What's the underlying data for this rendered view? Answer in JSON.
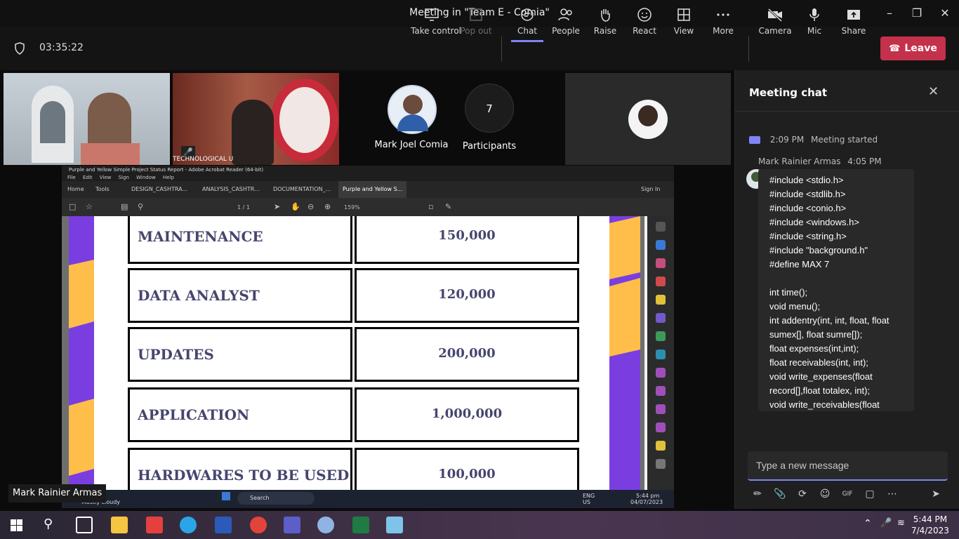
{
  "window": {
    "title": "Meeting in \"Team E - Comia\""
  },
  "meeting": {
    "timer": "03:35:22"
  },
  "toolbar": {
    "take_control": "Take control",
    "pop_out": "Pop out",
    "chat": "Chat",
    "people": "People",
    "raise": "Raise",
    "react": "React",
    "view": "View",
    "more": "More",
    "camera": "Camera",
    "mic": "Mic",
    "share": "Share",
    "leave": "Leave"
  },
  "participants": {
    "tile_name": "Mark Joel Comia",
    "count": "7",
    "count_label": "Participants",
    "tile2_caption": "TECHNOLOGICAL U"
  },
  "shared_screen": {
    "presenter": "Mark Rainier Armas",
    "app_title": "Purple and Yellow Simple Project Status Report - Adobe Acrobat Reader (64-bit)",
    "menu": [
      "File",
      "Edit",
      "View",
      "Sign",
      "Window",
      "Help"
    ],
    "nav": {
      "home": "Home",
      "tools": "Tools",
      "sign_in": "Sign In"
    },
    "tabs": [
      "DESIGN_CASHTRA...",
      "ANALYSIS_CASHTR...",
      "DOCUMENTATION_...",
      "Purple and Yellow S..."
    ],
    "page_indicator": "1 / 1",
    "zoom": "159%",
    "rows": [
      {
        "label": "MAINTENANCE",
        "value": "150,000"
      },
      {
        "label": "DATA ANALYST",
        "value": "120,000"
      },
      {
        "label": "UPDATES",
        "value": "200,000"
      },
      {
        "label": "APPLICATION",
        "value": "1,000,000"
      },
      {
        "label": "HARDWARES TO BE USED",
        "value": "100,000"
      }
    ],
    "taskbar": {
      "weather": "Mostly cloudy",
      "weather_temp": "C",
      "search": "Search",
      "lang": "ENG",
      "region": "US",
      "time": "5:44 pm",
      "date": "04/07/2023"
    }
  },
  "chat": {
    "title": "Meeting chat",
    "system_time": "2:09 PM",
    "system_text": "Meeting started",
    "sender": "Mark Rainier Armas",
    "sender_time": "4:05 PM",
    "message": "#include <stdio.h>\n#include <stdlib.h>\n#include <conio.h>\n#include <windows.h>\n#include <string.h>\n#include \"background.h\"\n#define MAX 7\n\nint time();\nvoid menu();\nint addentry(int, int, float, float sumex[], float sumre[]);\nfloat expenses(int,int);\nfloat receivables(int, int);\nvoid write_expenses(float record[],float totalex, int);\nvoid write_receivables(float",
    "input_placeholder": "Type a new message"
  },
  "system_tray": {
    "time": "5:44 PM",
    "date": "7/4/2023"
  },
  "colors": {
    "accent": "#7f85f5",
    "leave": "#c4314b",
    "doc_text": "#46456e",
    "stripe_purple": "#7a3ee0",
    "stripe_yellow": "#ffbe4a"
  }
}
